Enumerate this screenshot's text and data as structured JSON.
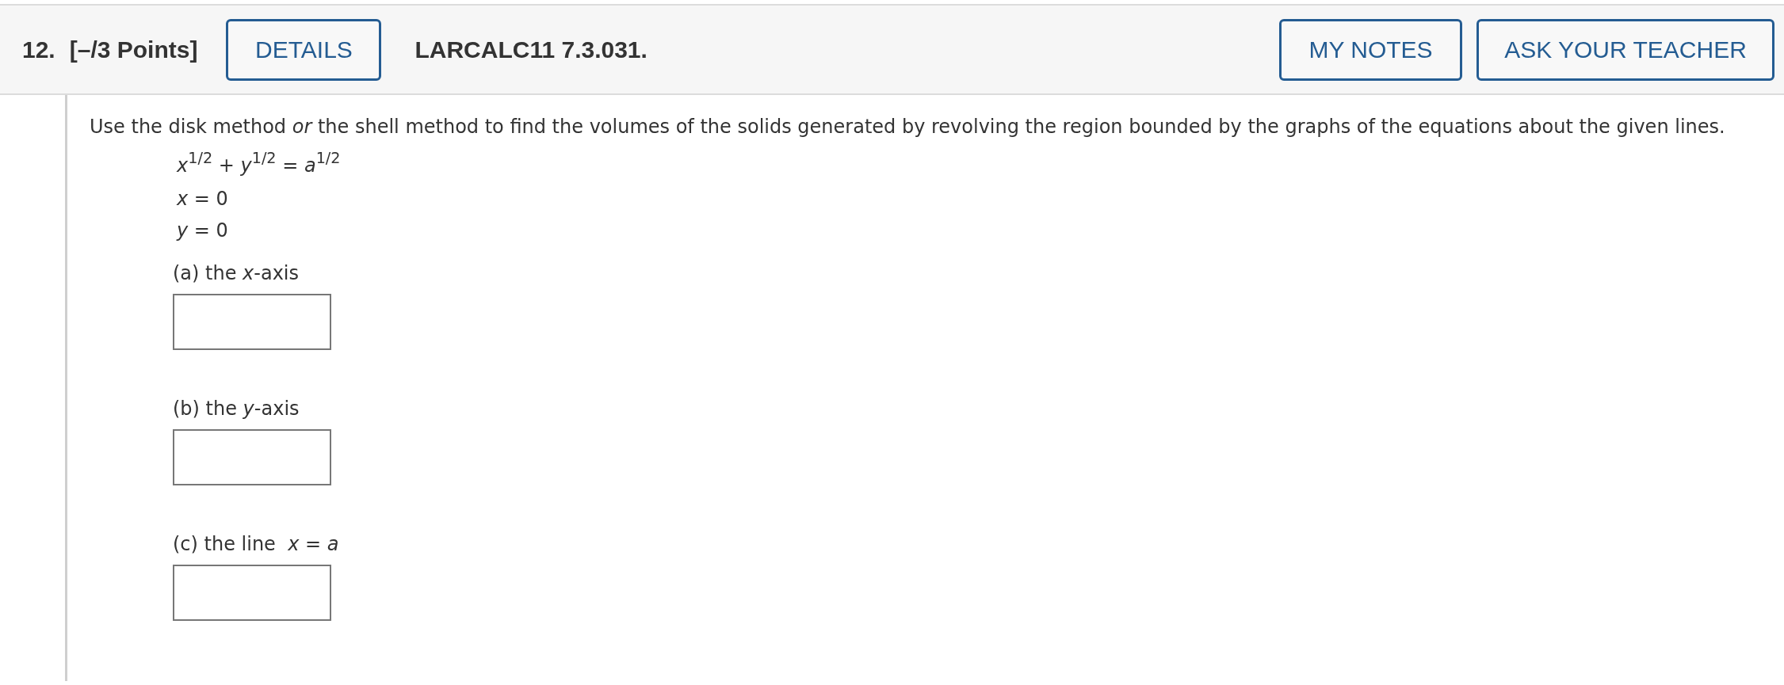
{
  "header": {
    "number": "12.",
    "points": "[–/3 Points]",
    "details_button": "DETAILS",
    "problem_id": "LARCALC11 7.3.031.",
    "buttons": [
      "MY NOTES",
      "ASK YOUR TEACHER"
    ]
  },
  "prompt": "Use the disk method *or* the shell method to find the volumes of the solids generated by revolving the region bounded by the graphs of the equations about the given lines.",
  "equations": [
    "*x*$^{1/2}$ + *y*$^{1/2}$ = *a*$^{1/2}$",
    "*x* = 0",
    "*y* = 0"
  ],
  "parts": [
    {
      "label": "(a) the *x*-axis"
    },
    {
      "label": "(b) the *y*-axis"
    },
    {
      "label": "(c) the line  *x* = *a*"
    }
  ]
}
